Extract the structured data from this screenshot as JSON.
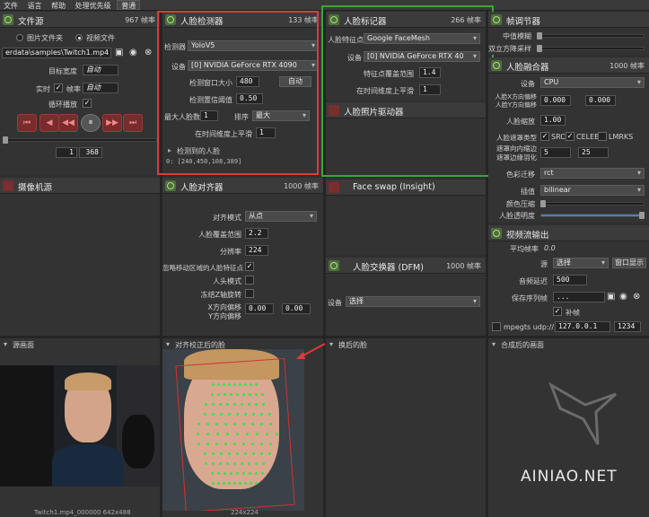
{
  "menu": {
    "file": "文件",
    "language": "语言",
    "help": "帮助",
    "priority_label": "处理优先级",
    "priority_value": "普通"
  },
  "file_source": {
    "title": "文件源",
    "fps": "967 帧率",
    "mode_image": "图片文件夹",
    "mode_video": "视频文件",
    "path": "erdata\\samples\\Twitch1.mp4",
    "target_width_label": "目标宽度",
    "target_width_value": "自动",
    "realtime_label": "实时",
    "fps_label": "帧率",
    "fps_value": "自动",
    "loop_label": "循环播放",
    "frame_current": "1",
    "frame_total": "368"
  },
  "face_detector": {
    "title": "人脸检测器",
    "fps": "133 帧率",
    "detector_label": "检测器",
    "detector_value": "YoloV5",
    "device_label": "设备",
    "device_value": "[0] NVIDIA GeForce RTX 4090",
    "window_label": "检测窗口大小",
    "window_value": "480",
    "window_auto": "自动",
    "threshold_label": "检测置信阈值",
    "threshold_value": "0.50",
    "max_faces_label": "最大人脸数",
    "max_faces_value": "1",
    "sort_label": "排序",
    "sort_value": "最大",
    "temporal_label": "在时间维度上平滑",
    "temporal_value": "1",
    "detected_label": "检测到的人脸",
    "detected_value": "0: [240,450,108,389]"
  },
  "face_marker": {
    "title": "人脸标记器",
    "fps": "266 帧率",
    "marker_label": "人脸特征点",
    "marker_value": "Google FaceMesh",
    "device_label": "设备",
    "device_value": "[0] NVIDIA GeForce RTX 40",
    "coverage_label": "特征点覆盖范围",
    "coverage_value": "1.4",
    "temporal_label": "在时间维度上平滑",
    "temporal_value": "1"
  },
  "face_animator": {
    "title": "人脸照片驱动器"
  },
  "frame_adjuster": {
    "title": "帧调节器",
    "median_label": "中值模糊",
    "degrade_label": "双立方降采样"
  },
  "face_merger": {
    "title": "人脸融合器",
    "fps": "1000 帧率",
    "device_label": "设备",
    "device_value": "CPU",
    "offset_label_1": "人脸X方向偏移",
    "offset_label_2": "人脸Y方向偏移",
    "offset_x": "0.000",
    "offset_y": "0.000",
    "scale_label": "人脸缩放",
    "scale_value": "1.00",
    "mask_type_label": "人脸遮罩类型",
    "mask_src": "SRC",
    "mask_celeb": "CELEB",
    "mask_lmrks": "LMRKS",
    "erode_label_1": "遮罩向内缩边",
    "erode_label_2": "遮罩边缘羽化",
    "erode_value": "5",
    "blur_value": "25",
    "color_transfer_label": "色彩迁移",
    "color_transfer_value": "rct",
    "interp_label": "插值",
    "interp_value": "bilinear",
    "color_comp_label": "颜色压缩",
    "opacity_label": "人脸透明度"
  },
  "camera_source": {
    "title": "摄像机源"
  },
  "face_aligner": {
    "title": "人脸对齐器",
    "fps": "1000 帧率",
    "align_mode_label": "对齐模式",
    "align_mode_value": "从点",
    "coverage_label": "人脸覆盖范围",
    "coverage_value": "2.2",
    "resolution_label": "分辨率",
    "resolution_value": "224",
    "exclude_moving_label": "忽略移动区域的人脸特征点",
    "head_mode_label": "人头模式",
    "freeze_z_label": "冻结Z轴旋转",
    "offset_x_label": "X方向偏移",
    "offset_y_label": "Y方向偏移",
    "offset_x": "0.00",
    "offset_y": "0.00"
  },
  "face_swap_insight": {
    "title": "Face swap (Insight)"
  },
  "face_swap_dfm": {
    "title": "人脸交换器 (DFM)",
    "fps": "1000 帧率",
    "device_label": "设备",
    "device_value": "选择"
  },
  "stream_output": {
    "title": "视频流输出",
    "avg_fps_label": "平均帧率",
    "avg_fps_value": "0.0",
    "source_label": "源",
    "source_value": "选择",
    "window_button": "窗口显示",
    "delay_label": "音频延迟",
    "delay_value": "500",
    "save_path_label": "保存序列帧",
    "save_path_value": "...",
    "fill_label": "补帧",
    "mpegts_label": "mpegts udp://",
    "ip_value": "127.0.0.1",
    "port_value": "1234"
  },
  "views": {
    "source_frame": "源画面",
    "aligned_face": "对齐校正后的脸",
    "swapped_face": "换后的脸",
    "merged_frame": "合成后的画面",
    "source_caption": "Twitch1.mp4_000000 642x488",
    "aligned_caption": "224x224",
    "watermark": "AINIAO.NET"
  },
  "colors": {
    "highlight_red": "#e03a3a",
    "highlight_green": "#3aa53a",
    "landmark": "#39e24a"
  }
}
